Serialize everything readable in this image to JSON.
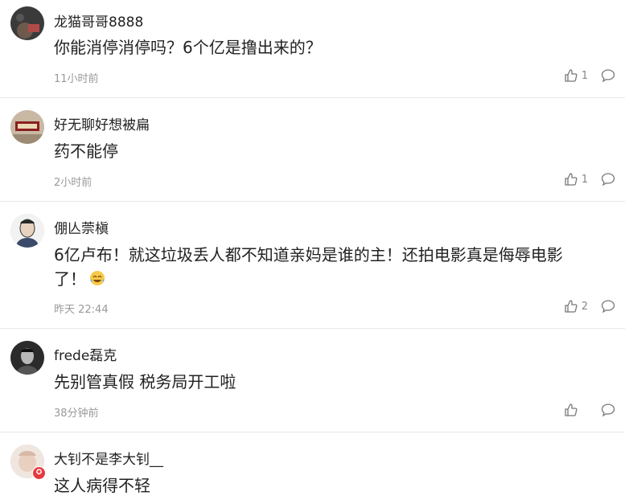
{
  "comments": [
    {
      "username": "龙猫哥哥8888",
      "content": "你能消停消停吗？6个亿是撸出来的？",
      "time": "11小时前",
      "likes": "1"
    },
    {
      "username": "好无聊好想被扁",
      "content": "药不能停",
      "time": "2小时前",
      "likes": "1"
    },
    {
      "username": "倗亾萗槇",
      "content_line1": "6亿卢布！就这垃圾丢人都不知道亲妈是谁的主！还拍电影真是侮辱电影",
      "content_line2": "了！",
      "time": "昨天 22:44",
      "likes": "2"
    },
    {
      "username": "frede磊克",
      "content": "先别管真假 税务局开工啦",
      "time": "38分钟前",
      "likes": ""
    },
    {
      "username": "大钊不是李大钊__",
      "content": "这人病得不轻"
    }
  ],
  "icons": {
    "like": "thumbs-up-icon",
    "reply": "speech-bubble-icon",
    "emoji": "laughing-tears-emoji"
  },
  "colors": {
    "text": "#222222",
    "muted": "#999999",
    "divider": "#e8e8e8",
    "badge": "#e6393d"
  }
}
